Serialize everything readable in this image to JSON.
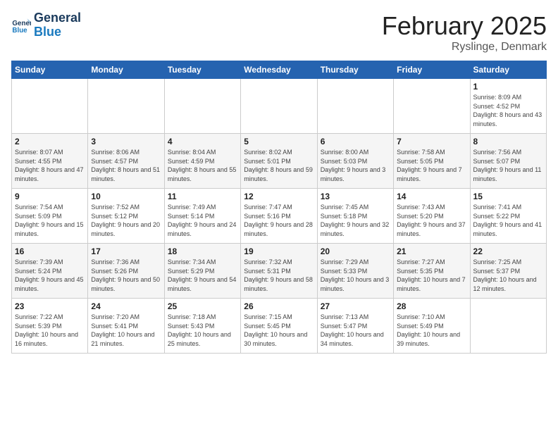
{
  "header": {
    "logo_line1": "General",
    "logo_line2": "Blue",
    "month": "February 2025",
    "location": "Ryslinge, Denmark"
  },
  "weekdays": [
    "Sunday",
    "Monday",
    "Tuesday",
    "Wednesday",
    "Thursday",
    "Friday",
    "Saturday"
  ],
  "weeks": [
    [
      {
        "day": "",
        "info": ""
      },
      {
        "day": "",
        "info": ""
      },
      {
        "day": "",
        "info": ""
      },
      {
        "day": "",
        "info": ""
      },
      {
        "day": "",
        "info": ""
      },
      {
        "day": "",
        "info": ""
      },
      {
        "day": "1",
        "info": "Sunrise: 8:09 AM\nSunset: 4:52 PM\nDaylight: 8 hours and 43 minutes."
      }
    ],
    [
      {
        "day": "2",
        "info": "Sunrise: 8:07 AM\nSunset: 4:55 PM\nDaylight: 8 hours and 47 minutes."
      },
      {
        "day": "3",
        "info": "Sunrise: 8:06 AM\nSunset: 4:57 PM\nDaylight: 8 hours and 51 minutes."
      },
      {
        "day": "4",
        "info": "Sunrise: 8:04 AM\nSunset: 4:59 PM\nDaylight: 8 hours and 55 minutes."
      },
      {
        "day": "5",
        "info": "Sunrise: 8:02 AM\nSunset: 5:01 PM\nDaylight: 8 hours and 59 minutes."
      },
      {
        "day": "6",
        "info": "Sunrise: 8:00 AM\nSunset: 5:03 PM\nDaylight: 9 hours and 3 minutes."
      },
      {
        "day": "7",
        "info": "Sunrise: 7:58 AM\nSunset: 5:05 PM\nDaylight: 9 hours and 7 minutes."
      },
      {
        "day": "8",
        "info": "Sunrise: 7:56 AM\nSunset: 5:07 PM\nDaylight: 9 hours and 11 minutes."
      }
    ],
    [
      {
        "day": "9",
        "info": "Sunrise: 7:54 AM\nSunset: 5:09 PM\nDaylight: 9 hours and 15 minutes."
      },
      {
        "day": "10",
        "info": "Sunrise: 7:52 AM\nSunset: 5:12 PM\nDaylight: 9 hours and 20 minutes."
      },
      {
        "day": "11",
        "info": "Sunrise: 7:49 AM\nSunset: 5:14 PM\nDaylight: 9 hours and 24 minutes."
      },
      {
        "day": "12",
        "info": "Sunrise: 7:47 AM\nSunset: 5:16 PM\nDaylight: 9 hours and 28 minutes."
      },
      {
        "day": "13",
        "info": "Sunrise: 7:45 AM\nSunset: 5:18 PM\nDaylight: 9 hours and 32 minutes."
      },
      {
        "day": "14",
        "info": "Sunrise: 7:43 AM\nSunset: 5:20 PM\nDaylight: 9 hours and 37 minutes."
      },
      {
        "day": "15",
        "info": "Sunrise: 7:41 AM\nSunset: 5:22 PM\nDaylight: 9 hours and 41 minutes."
      }
    ],
    [
      {
        "day": "16",
        "info": "Sunrise: 7:39 AM\nSunset: 5:24 PM\nDaylight: 9 hours and 45 minutes."
      },
      {
        "day": "17",
        "info": "Sunrise: 7:36 AM\nSunset: 5:26 PM\nDaylight: 9 hours and 50 minutes."
      },
      {
        "day": "18",
        "info": "Sunrise: 7:34 AM\nSunset: 5:29 PM\nDaylight: 9 hours and 54 minutes."
      },
      {
        "day": "19",
        "info": "Sunrise: 7:32 AM\nSunset: 5:31 PM\nDaylight: 9 hours and 58 minutes."
      },
      {
        "day": "20",
        "info": "Sunrise: 7:29 AM\nSunset: 5:33 PM\nDaylight: 10 hours and 3 minutes."
      },
      {
        "day": "21",
        "info": "Sunrise: 7:27 AM\nSunset: 5:35 PM\nDaylight: 10 hours and 7 minutes."
      },
      {
        "day": "22",
        "info": "Sunrise: 7:25 AM\nSunset: 5:37 PM\nDaylight: 10 hours and 12 minutes."
      }
    ],
    [
      {
        "day": "23",
        "info": "Sunrise: 7:22 AM\nSunset: 5:39 PM\nDaylight: 10 hours and 16 minutes."
      },
      {
        "day": "24",
        "info": "Sunrise: 7:20 AM\nSunset: 5:41 PM\nDaylight: 10 hours and 21 minutes."
      },
      {
        "day": "25",
        "info": "Sunrise: 7:18 AM\nSunset: 5:43 PM\nDaylight: 10 hours and 25 minutes."
      },
      {
        "day": "26",
        "info": "Sunrise: 7:15 AM\nSunset: 5:45 PM\nDaylight: 10 hours and 30 minutes."
      },
      {
        "day": "27",
        "info": "Sunrise: 7:13 AM\nSunset: 5:47 PM\nDaylight: 10 hours and 34 minutes."
      },
      {
        "day": "28",
        "info": "Sunrise: 7:10 AM\nSunset: 5:49 PM\nDaylight: 10 hours and 39 minutes."
      },
      {
        "day": "",
        "info": ""
      }
    ]
  ]
}
